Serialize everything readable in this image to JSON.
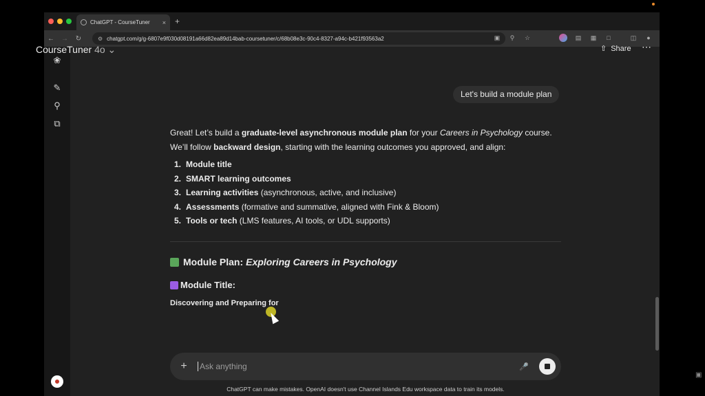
{
  "browser": {
    "tab_title": "ChatGPT - CourseTuner",
    "tab_close": "×",
    "new_tab": "+",
    "url": "chatgpt.com/g/g-6807e9f030d08191a66d82ea89d14bab-coursetuner/c/68b08e3c-90c4-8327-a94c-b421f93563a2",
    "traffic_colors": [
      "#ff5f57",
      "#febc2e",
      "#28c840"
    ]
  },
  "header": {
    "app_name": "CourseTuner",
    "model": "4o",
    "share_label": "Share"
  },
  "chat": {
    "user_message": "Let's build a module plan",
    "intro": {
      "p1_a": "Great! Let’s build a ",
      "p1_b": "graduate-level asynchronous module plan",
      "p1_c": " for your ",
      "p1_d": "Careers in Psychology",
      "p1_e": " course.",
      "p2_a": "We’ll follow ",
      "p2_b": "backward design",
      "p2_c": ", starting with the learning outcomes you approved, and align:"
    },
    "list": [
      {
        "num": "1.",
        "bold": "Module title",
        "rest": ""
      },
      {
        "num": "2.",
        "bold": "SMART learning outcomes",
        "rest": ""
      },
      {
        "num": "3.",
        "bold": "Learning activities",
        "rest": " (asynchronous, active, and inclusive)"
      },
      {
        "num": "4.",
        "bold": "Assessments",
        "rest": " (formative and summative, aligned with Fink & Bloom)"
      },
      {
        "num": "5.",
        "bold": "Tools or tech",
        "rest": " (LMS features, AI tools, or UDL supports)"
      }
    ],
    "heading_prefix": "Module Plan: ",
    "heading_italic": "Exploring Careers in Psychology",
    "subheading": "Module Title:",
    "paragraph": "Discovering and Preparing for"
  },
  "composer": {
    "placeholder": "Ask anything"
  },
  "footer": {
    "disclaimer": "ChatGPT can make mistakes. OpenAI doesn't use Channel Islands Edu workspace data to train its models."
  }
}
